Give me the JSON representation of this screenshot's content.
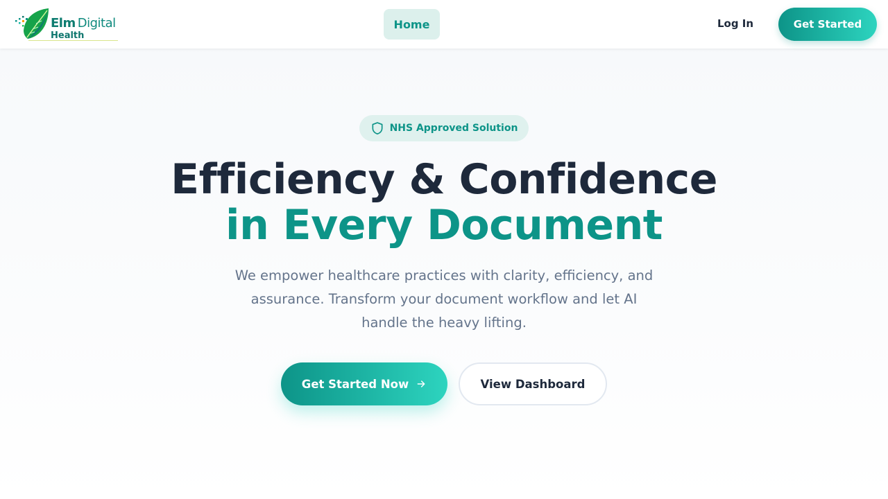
{
  "header": {
    "logo": {
      "word1_bold": "Elm",
      "word1_light": "Digital",
      "word2": "Health"
    },
    "nav": {
      "home_label": "Home"
    },
    "login_label": "Log In",
    "get_started_label": "Get Started"
  },
  "hero": {
    "badge": {
      "icon": "shield-icon",
      "text": "NHS Approved Solution"
    },
    "title_line1": "Efficiency & Confidence",
    "title_line2": "in Every Document",
    "subtitle": "We empower healthcare practices with clarity, efficiency, and assurance. Transform your document workflow and let AI handle the heavy lifting.",
    "primary_cta": {
      "label": "Get Started Now",
      "icon": "arrow-right-icon"
    },
    "secondary_cta": {
      "label": "View Dashboard"
    }
  },
  "colors": {
    "accent": "#0d9488",
    "accent_light": "#2dd4bf",
    "heading": "#1e293b",
    "muted": "#64748b"
  }
}
